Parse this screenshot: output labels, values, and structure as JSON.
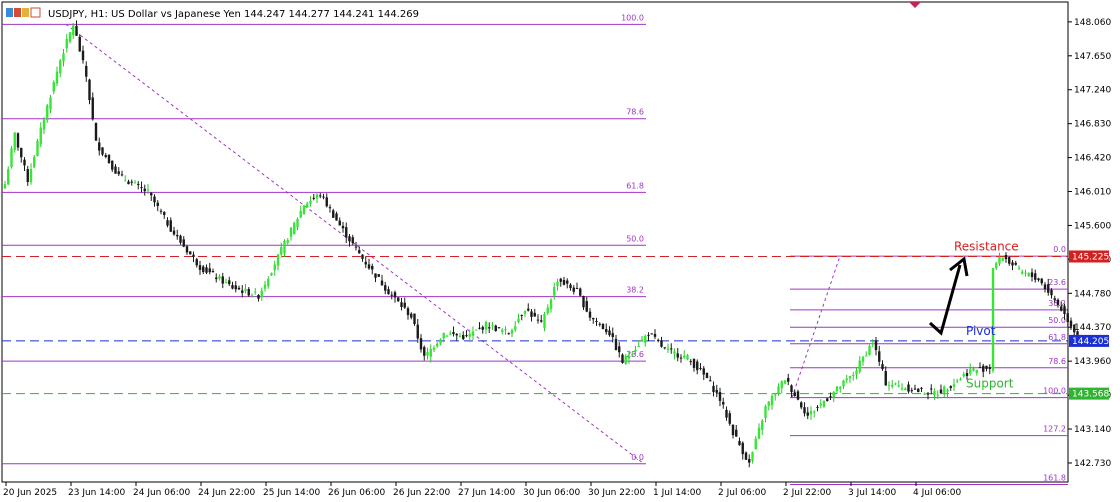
{
  "chart_data": {
    "type": "candlestick",
    "title": "USDJPY, H1:  US Dollar vs Japanese Yen  144.247 144.277 144.241 144.269",
    "symbol": "USDJPY",
    "timeframe": "H1",
    "description": "US Dollar vs Japanese Yen",
    "last_ohlc": {
      "open": 144.247,
      "high": 144.277,
      "low": 144.241,
      "close": 144.269
    },
    "ylim": [
      142.5,
      148.3
    ],
    "y_ticks": [
      "148.060",
      "147.650",
      "147.240",
      "146.830",
      "146.420",
      "146.010",
      "145.600",
      "145.190",
      "144.780",
      "144.370",
      "143.960",
      "143.550",
      "143.140",
      "142.730"
    ],
    "x_ticks": [
      "20 Jun 2025",
      "23 Jun 14:00",
      "24 Jun 06:00",
      "24 Jun 22:00",
      "25 Jun 14:00",
      "26 Jun 06:00",
      "26 Jun 22:00",
      "27 Jun 14:00",
      "30 Jun 06:00",
      "30 Jun 22:00",
      "1 Jul 14:00",
      "2 Jul 06:00",
      "2 Jul 22:00",
      "3 Jul 14:00",
      "4 Jul 06:00"
    ],
    "key_prices": [
      {
        "id": "resistance",
        "label": "Resistance",
        "price": 145.225,
        "tag": "145.225",
        "color": "#d42020"
      },
      {
        "id": "pivot",
        "label": "Pivot",
        "price": 144.205,
        "tag": "144.205",
        "color": "#1a2fd6"
      },
      {
        "id": "support",
        "label": "Support",
        "price": 143.568,
        "tag": "143.568",
        "color": "#2fb52f"
      }
    ],
    "fib_left": {
      "color": "#a034c8",
      "high": 148.03,
      "low": 142.72,
      "levels": [
        {
          "label": "100.0",
          "price": 148.03
        },
        {
          "label": "78.6",
          "price": 146.89
        },
        {
          "label": "61.8",
          "price": 146.0
        },
        {
          "label": "50.0",
          "price": 145.36
        },
        {
          "label": "38.2",
          "price": 144.74
        },
        {
          "label": "23.6",
          "price": 143.96
        },
        {
          "label": "0.0",
          "price": 142.72
        }
      ]
    },
    "fib_right": {
      "color": "#a034c8",
      "high": 145.23,
      "low": 143.52,
      "levels": [
        {
          "label": "0.0",
          "price": 145.23
        },
        {
          "label": "23.6",
          "price": 144.83
        },
        {
          "label": "38.2",
          "price": 144.58
        },
        {
          "label": "50.0",
          "price": 144.37
        },
        {
          "label": "61.8",
          "price": 144.17
        },
        {
          "label": "78.6",
          "price": 143.88
        },
        {
          "label": "100.0",
          "price": 143.52
        },
        {
          "label": "127.2",
          "price": 143.06
        },
        {
          "label": "161.8",
          "price": 142.47
        }
      ]
    },
    "series": [
      {
        "name": "",
        "anchors": [
          [
            0,
            146.1
          ],
          [
            3,
            146.7
          ],
          [
            7,
            146.15
          ],
          [
            12,
            146.9
          ],
          [
            17,
            147.6
          ],
          [
            21,
            148.03
          ],
          [
            25,
            147.4
          ],
          [
            28,
            146.6
          ],
          [
            35,
            146.2
          ],
          [
            44,
            146.0
          ],
          [
            52,
            145.5
          ],
          [
            60,
            145.1
          ],
          [
            70,
            144.85
          ],
          [
            78,
            144.75
          ],
          [
            85,
            145.3
          ],
          [
            92,
            145.85
          ],
          [
            97,
            145.98
          ],
          [
            103,
            145.6
          ],
          [
            110,
            145.2
          ],
          [
            118,
            144.8
          ],
          [
            125,
            144.5
          ],
          [
            129,
            144.0
          ],
          [
            135,
            144.3
          ],
          [
            142,
            144.25
          ],
          [
            148,
            144.4
          ],
          [
            155,
            144.3
          ],
          [
            160,
            144.6
          ],
          [
            165,
            144.4
          ],
          [
            170,
            144.95
          ],
          [
            176,
            144.8
          ],
          [
            180,
            144.5
          ],
          [
            186,
            144.3
          ],
          [
            190,
            143.95
          ],
          [
            198,
            144.3
          ],
          [
            203,
            144.1
          ],
          [
            210,
            144.0
          ],
          [
            216,
            143.75
          ],
          [
            220,
            143.5
          ],
          [
            224,
            143.1
          ],
          [
            229,
            142.72
          ],
          [
            234,
            143.4
          ],
          [
            240,
            143.75
          ],
          [
            247,
            143.3
          ],
          [
            254,
            143.55
          ],
          [
            261,
            143.8
          ],
          [
            267,
            144.2
          ],
          [
            271,
            143.7
          ],
          [
            276,
            143.65
          ],
          [
            281,
            143.6
          ],
          [
            287,
            143.58
          ],
          [
            292,
            143.7
          ],
          [
            297,
            143.85
          ],
          [
            303,
            143.88
          ],
          [
            304,
            145.1
          ],
          [
            307,
            145.23
          ],
          [
            312,
            145.05
          ],
          [
            318,
            144.95
          ],
          [
            324,
            144.65
          ],
          [
            330,
            144.27
          ]
        ]
      }
    ]
  }
}
